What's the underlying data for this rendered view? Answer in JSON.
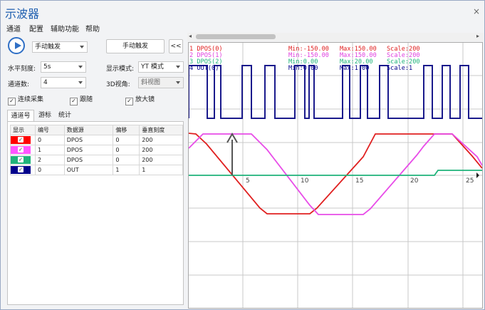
{
  "window": {
    "title": "示波器",
    "close_glyph": "×"
  },
  "menu": [
    "通道",
    "配置",
    "辅助功能",
    "帮助"
  ],
  "controls": {
    "trigger_mode": "手动触发",
    "trigger_button": "手动触发",
    "collapse_button": "<<",
    "horizontal_scale_label": "水平刻度:",
    "horizontal_scale_value": "5s",
    "display_mode_label": "显示模式:",
    "display_mode_value": "YT 模式",
    "channel_count_label": "通道数:",
    "channel_count_value": "4",
    "view3d_label": "3D视角:",
    "view3d_value": "斜视图",
    "checkboxes": [
      {
        "label": "连续采集",
        "checked": true
      },
      {
        "label": "跟随",
        "checked": true
      },
      {
        "label": "放大镜",
        "checked": true
      }
    ]
  },
  "tabs": [
    "通道号",
    "游标",
    "统计"
  ],
  "active_tab": "通道号",
  "table": {
    "headers": [
      "显示",
      "编号",
      "数据源",
      "偏移",
      "垂直刻度"
    ],
    "rows": [
      {
        "color": "#ff0000",
        "checked": true,
        "id": "0",
        "source": "DPOS",
        "offset": "0",
        "scale": "200"
      },
      {
        "color": "#ff55ff",
        "checked": true,
        "id": "1",
        "source": "DPOS",
        "offset": "0",
        "scale": "200"
      },
      {
        "color": "#1fb37a",
        "checked": true,
        "id": "2",
        "source": "DPOS",
        "offset": "0",
        "scale": "200"
      },
      {
        "color": "#00008b",
        "checked": true,
        "id": "0",
        "source": "OUT",
        "offset": "1",
        "scale": "1"
      }
    ]
  },
  "scope": {
    "scroll_left": "◂",
    "scroll_right": "▸",
    "legend": [
      {
        "color": "#e02020",
        "name": "1 DPOS(0)",
        "min": "Min:-150.00",
        "max": "Max:150.00",
        "scale": "Scale:200"
      },
      {
        "color": "#e040e0",
        "name": "2 DPOS(1)",
        "min": "Min:-150.00",
        "max": "Max:150.00",
        "scale": "Scale:200"
      },
      {
        "color": "#1fb37a",
        "name": "3 DPOS(2)",
        "min": "Min:0.00",
        "max": "Max:20.00",
        "scale": "Scale:200"
      },
      {
        "color": "#00008b",
        "name": "4 OUT(0)",
        "min": "Min:0.00",
        "max": "Max:1.00",
        "scale": "Scale:1"
      }
    ],
    "time_ticks": [
      "5",
      "10",
      "15",
      "20",
      "25"
    ]
  }
}
